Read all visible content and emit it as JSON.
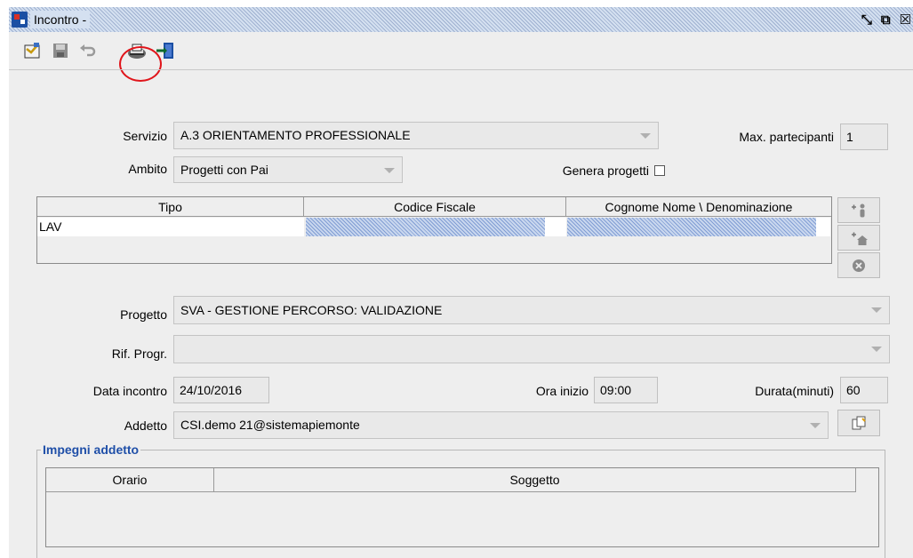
{
  "window": {
    "title": "Incontro -"
  },
  "toolbar": {
    "tools": [
      {
        "name": "new-icon"
      },
      {
        "name": "save-icon"
      },
      {
        "name": "undo-icon"
      },
      {
        "name": "print-icon"
      },
      {
        "name": "exit-icon"
      }
    ]
  },
  "form": {
    "servizio_label": "Servizio",
    "servizio_value": "A.3 ORIENTAMENTO PROFESSIONALE",
    "max_label": "Max. partecipanti",
    "max_value": "1",
    "ambito_label": "Ambito",
    "ambito_value": "Progetti con Pai",
    "genera_label": "Genera progetti",
    "progetto_label": "Progetto",
    "progetto_value": "SVA - GESTIONE PERCORSO: VALIDAZIONE",
    "rif_label": "Rif. Progr.",
    "rif_value": "",
    "data_label": "Data incontro",
    "data_value": "24/10/2016",
    "ora_label": "Ora inizio",
    "ora_value": "09:00",
    "durata_label": "Durata(minuti)",
    "durata_value": "60",
    "addetto_label": "Addetto",
    "addetto_value": "CSI.demo 21@sistemapiemonte"
  },
  "participants": {
    "headers": [
      "Tipo",
      "Codice Fiscale",
      "Cognome Nome \\ Denominazione"
    ],
    "rows": [
      {
        "tipo": "LAV",
        "codice": "",
        "nome": ""
      }
    ]
  },
  "impegni": {
    "legend": "Impegni addetto",
    "headers": [
      "Orario",
      "Soggetto"
    ]
  },
  "colors": {
    "accent": "#1f4fa8",
    "highlight_circle": "#e0151b",
    "background": "#eeeeee"
  }
}
